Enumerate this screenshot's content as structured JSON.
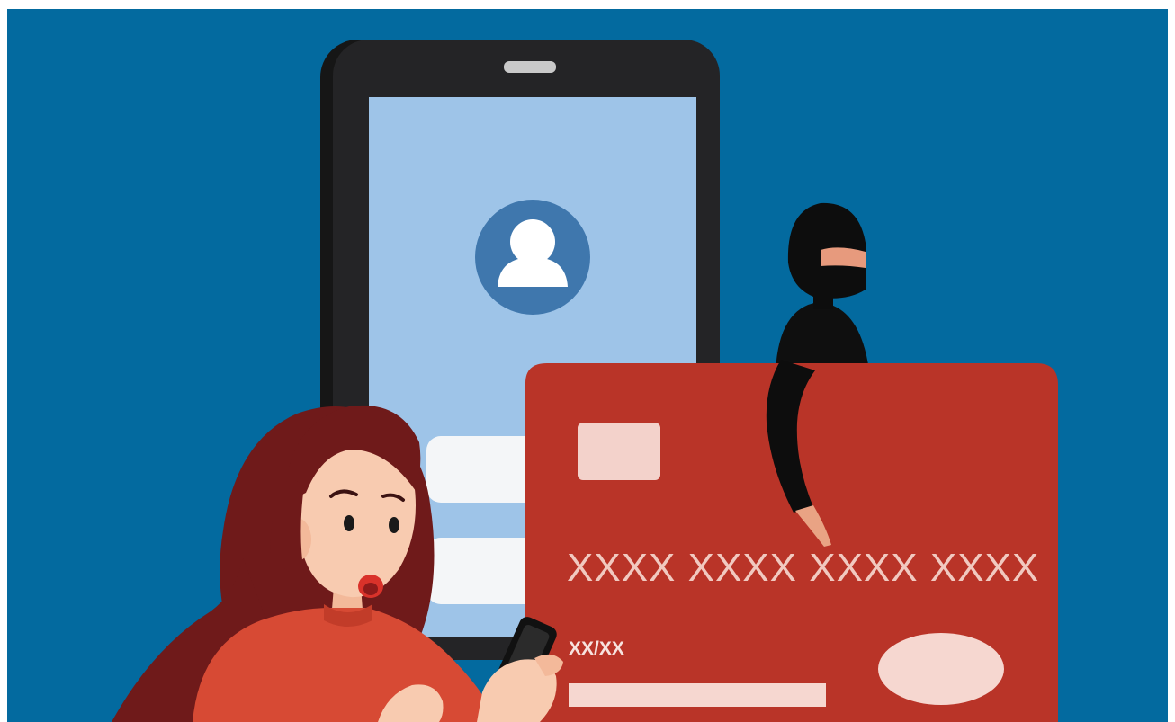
{
  "card": {
    "number": "XXXX XXXX XXXX XXXX",
    "expiry": "XX/XX"
  },
  "colors": {
    "background": "#036a9f",
    "phone_body": "#1c1c1e",
    "phone_screen": "#9ec4e8",
    "avatar_circle": "#3f77ad",
    "card": "#b93428",
    "card_text": "#f1c9c0",
    "woman_hair": "#6f1a1a",
    "woman_skin": "#f8cbb0",
    "woman_sweater": "#d74a34",
    "thief": "#0d0d0d"
  },
  "icons": [
    "user-avatar-icon",
    "credit-card-chip",
    "smartphone"
  ]
}
